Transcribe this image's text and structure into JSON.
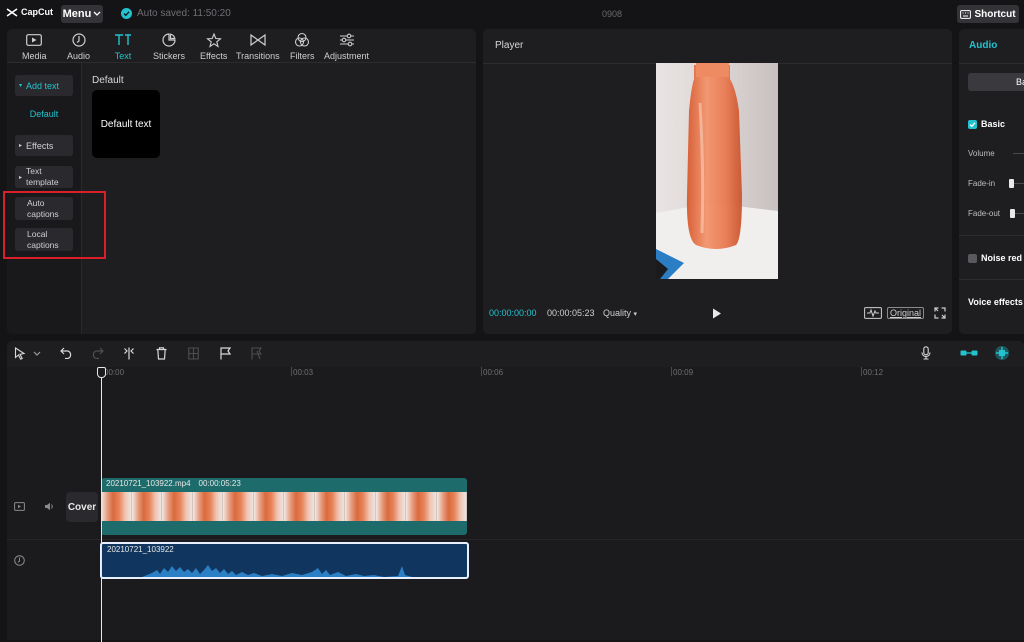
{
  "app": {
    "logo_text": "CapCut",
    "menu_label": "Menu",
    "autosave_text": "Auto saved: 11:50:20",
    "project_name": "0908",
    "shortcut_label": "Shortcut"
  },
  "tabs": [
    {
      "label": "Media",
      "icon": "media-icon"
    },
    {
      "label": "Audio",
      "icon": "audio-icon"
    },
    {
      "label": "Text",
      "icon": "text-icon",
      "active": true
    },
    {
      "label": "Stickers",
      "icon": "stickers-icon"
    },
    {
      "label": "Effects",
      "icon": "effects-icon"
    },
    {
      "label": "Transitions",
      "icon": "transitions-icon"
    },
    {
      "label": "Filters",
      "icon": "filters-icon"
    },
    {
      "label": "Adjustment",
      "icon": "adjustment-icon"
    }
  ],
  "sidebar": {
    "add_text": "Add text",
    "default": "Default",
    "effects": "Effects",
    "text_template_1": "Text",
    "text_template_2": "template",
    "auto_captions_1": "Auto",
    "auto_captions_2": "captions",
    "local_captions_1": "Local",
    "local_captions_2": "captions"
  },
  "content": {
    "section_title": "Default",
    "card_label": "Default text"
  },
  "player": {
    "title": "Player",
    "current_time": "00:00:00:00",
    "duration": "00:00:05:23",
    "quality_label": "Quality",
    "original_label": "Original"
  },
  "audio_panel": {
    "title": "Audio",
    "segment_label": "Ba",
    "basic_label": "Basic",
    "volume_label": "Volume",
    "fade_in_label": "Fade-in",
    "fade_out_label": "Fade-out",
    "noise_label": "Noise red",
    "voice_effects_label": "Voice effects"
  },
  "timeline": {
    "ruler": [
      "00:00",
      "00:03",
      "00:06",
      "00:09",
      "00:12"
    ],
    "cover_label": "Cover",
    "video_clip_name": "20210721_103922.mp4",
    "video_clip_duration": "00:00:05:23",
    "audio_clip_name": "20210721_103922"
  },
  "colors": {
    "accent": "#22c3cf",
    "highlight": "#d9202a",
    "video_clip": "#1e6b6b",
    "audio_clip": "#10365f"
  }
}
